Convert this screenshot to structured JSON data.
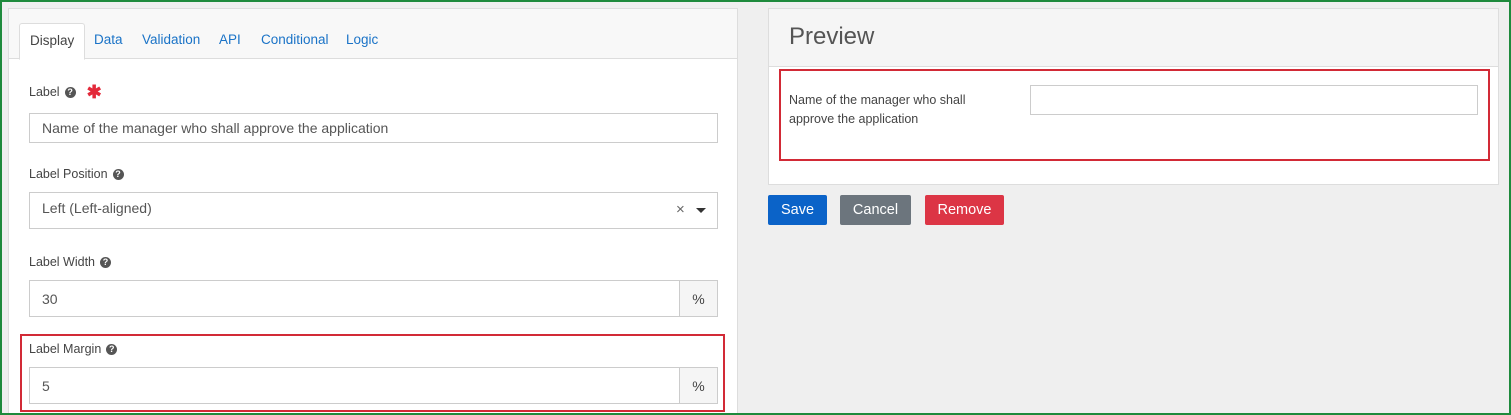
{
  "tabs": [
    {
      "label": "Display"
    },
    {
      "label": "Data"
    },
    {
      "label": "Validation"
    },
    {
      "label": "API"
    },
    {
      "label": "Conditional"
    },
    {
      "label": "Logic"
    }
  ],
  "fields": {
    "label": {
      "title": "Label",
      "required_mark": "✱",
      "value": "Name of the manager who shall approve the application"
    },
    "label_position": {
      "title": "Label Position",
      "value": "Left (Left-aligned)",
      "clear": "×"
    },
    "label_width": {
      "title": "Label Width",
      "value": "30",
      "suffix": "%"
    },
    "label_margin": {
      "title": "Label Margin",
      "value": "5",
      "suffix": "%"
    }
  },
  "help_icon": "?",
  "preview": {
    "title": "Preview",
    "field_label": "Name of the manager who shall approve the application",
    "field_value": ""
  },
  "buttons": {
    "save": "Save",
    "cancel": "Cancel",
    "remove": "Remove"
  },
  "colors": {
    "save": "#0b63c8",
    "cancel": "#6c757d",
    "remove": "#dc3545",
    "highlight": "#d22a36",
    "frame": "#1e8a3c"
  }
}
